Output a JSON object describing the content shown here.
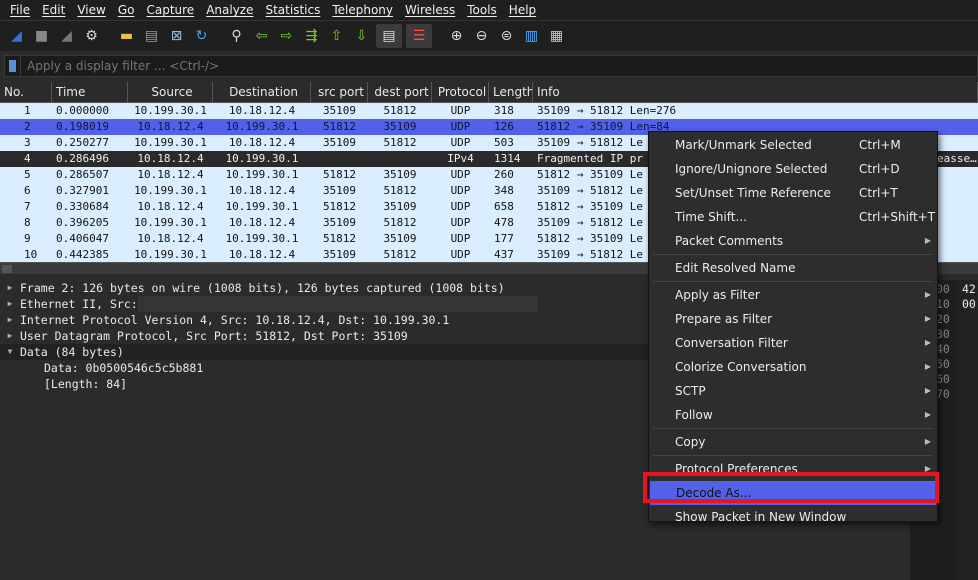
{
  "menu": [
    "File",
    "Edit",
    "View",
    "Go",
    "Capture",
    "Analyze",
    "Statistics",
    "Telephony",
    "Wireless",
    "Tools",
    "Help"
  ],
  "toolbar": [
    "start-capture-icon",
    "stop-capture-icon",
    "restart-capture-icon",
    "capture-options-icon",
    "open-file-icon",
    "save-file-icon",
    "close-file-icon",
    "reload-file-icon",
    "find-packet-icon",
    "go-back-icon",
    "go-forward-icon",
    "go-to-packet-icon",
    "first-packet-icon",
    "last-packet-icon",
    "autoscroll-icon",
    "colorize-icon",
    "zoom-in-icon",
    "zoom-out-icon",
    "normal-size-icon",
    "resize-columns-icon",
    "layout-icon"
  ],
  "filter": {
    "placeholder": "Apply a display filter ... <Ctrl-/>"
  },
  "columns": [
    "No.",
    "Time",
    "Source",
    "Destination",
    "src port",
    "dest port",
    "Protocol",
    "Length",
    "Info"
  ],
  "packets": [
    [
      "1",
      "0.000000",
      "10.199.30.1",
      "10.18.12.4",
      "35109",
      "51812",
      "UDP",
      "318",
      "35109 → 51812 Len=276"
    ],
    [
      "2",
      "0.198019",
      "10.18.12.4",
      "10.199.30.1",
      "51812",
      "35109",
      "UDP",
      "126",
      "51812 → 35109 Len=84"
    ],
    [
      "3",
      "0.250277",
      "10.199.30.1",
      "10.18.12.4",
      "35109",
      "51812",
      "UDP",
      "503",
      "35109 → 51812 Le"
    ],
    [
      "4",
      "0.286496",
      "10.18.12.4",
      "10.199.30.1",
      "",
      "",
      "IPv4",
      "1314",
      "Fragmented IP pr"
    ],
    [
      "5",
      "0.286507",
      "10.18.12.4",
      "10.199.30.1",
      "51812",
      "35109",
      "UDP",
      "260",
      "51812 → 35109 Le"
    ],
    [
      "6",
      "0.327901",
      "10.199.30.1",
      "10.18.12.4",
      "35109",
      "51812",
      "UDP",
      "348",
      "35109 → 51812 Le"
    ],
    [
      "7",
      "0.330684",
      "10.18.12.4",
      "10.199.30.1",
      "51812",
      "35109",
      "UDP",
      "658",
      "51812 → 35109 Le"
    ],
    [
      "8",
      "0.396205",
      "10.199.30.1",
      "10.18.12.4",
      "35109",
      "51812",
      "UDP",
      "478",
      "35109 → 51812 Le"
    ],
    [
      "9",
      "0.406047",
      "10.18.12.4",
      "10.199.30.1",
      "51812",
      "35109",
      "UDP",
      "177",
      "51812 → 35109 Le"
    ],
    [
      "10",
      "0.442385",
      "10.199.30.1",
      "10.18.12.4",
      "35109",
      "51812",
      "UDP",
      "437",
      "35109 → 51812 Le"
    ]
  ],
  "row4_tail": "easse…",
  "details": [
    {
      "text": "Frame 2: 126 bytes on wire (1008 bits), 126 bytes captured (1008 bits)",
      "expanded": false
    },
    {
      "text": "Ethernet II, Src:",
      "expanded": false
    },
    {
      "text": "Internet Protocol Version 4, Src: 10.18.12.4, Dst: 10.199.30.1",
      "expanded": false
    },
    {
      "text": "User Datagram Protocol, Src Port: 51812, Dst Port: 35109",
      "expanded": false
    },
    {
      "text": "Data (84 bytes)",
      "expanded": true
    }
  ],
  "data_children": [
    "Data: 0b0500546c5c5b881",
    "[Length: 84]"
  ],
  "bytes": {
    "offsets": [
      "00",
      "10",
      "20",
      "30",
      "40",
      "50",
      "60",
      "70"
    ],
    "hex": [
      "42",
      "00"
    ]
  },
  "context_menu": [
    {
      "label": "Mark/Unmark Selected",
      "shortcut": "Ctrl+M"
    },
    {
      "label": "Ignore/Unignore Selected",
      "shortcut": "Ctrl+D"
    },
    {
      "label": "Set/Unset Time Reference",
      "shortcut": "Ctrl+T"
    },
    {
      "label": "Time Shift...",
      "shortcut": "Ctrl+Shift+T"
    },
    {
      "label": "Packet Comments",
      "submenu": true
    },
    {
      "sep": true
    },
    {
      "label": "Edit Resolved Name"
    },
    {
      "sep": true
    },
    {
      "label": "Apply as Filter",
      "submenu": true
    },
    {
      "label": "Prepare as Filter",
      "submenu": true
    },
    {
      "label": "Conversation Filter",
      "submenu": true
    },
    {
      "label": "Colorize Conversation",
      "submenu": true
    },
    {
      "label": "SCTP",
      "submenu": true
    },
    {
      "label": "Follow",
      "submenu": true
    },
    {
      "sep": true
    },
    {
      "label": "Copy",
      "submenu": true
    },
    {
      "sep": true
    },
    {
      "label": "Protocol Preferences",
      "submenu": true
    },
    {
      "label": "Decode As...",
      "highlighted": true
    },
    {
      "label": "Show Packet in New Window"
    }
  ],
  "colors": {
    "selected_row": "#5161e8",
    "row_bg": "#dbeeff",
    "highlight_box": "#e8141e"
  }
}
